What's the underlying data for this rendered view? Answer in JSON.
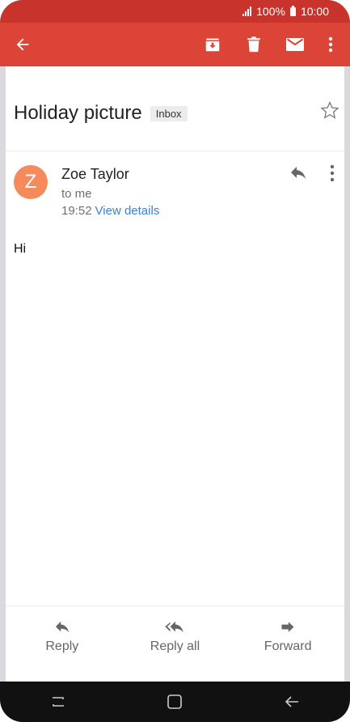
{
  "status_bar": {
    "battery": "100%",
    "time": "10:00"
  },
  "toolbar": {
    "back_icon": "arrow-back-icon",
    "archive_icon": "archive-icon",
    "delete_icon": "delete-icon",
    "mark_unread_icon": "mail-icon",
    "more_icon": "more-vert-icon",
    "accent_color": "#db4437"
  },
  "email": {
    "subject": "Holiday picture",
    "label": "Inbox",
    "sender_initial": "Z",
    "sender_name": "Zoe Taylor",
    "recipient": "to me",
    "time": "19:52",
    "details_link": "View details",
    "body": "Hi",
    "avatar_color": "#f58a5d"
  },
  "actions": {
    "reply_label": "Reply",
    "reply_all_label": "Reply all",
    "forward_label": "Forward"
  }
}
